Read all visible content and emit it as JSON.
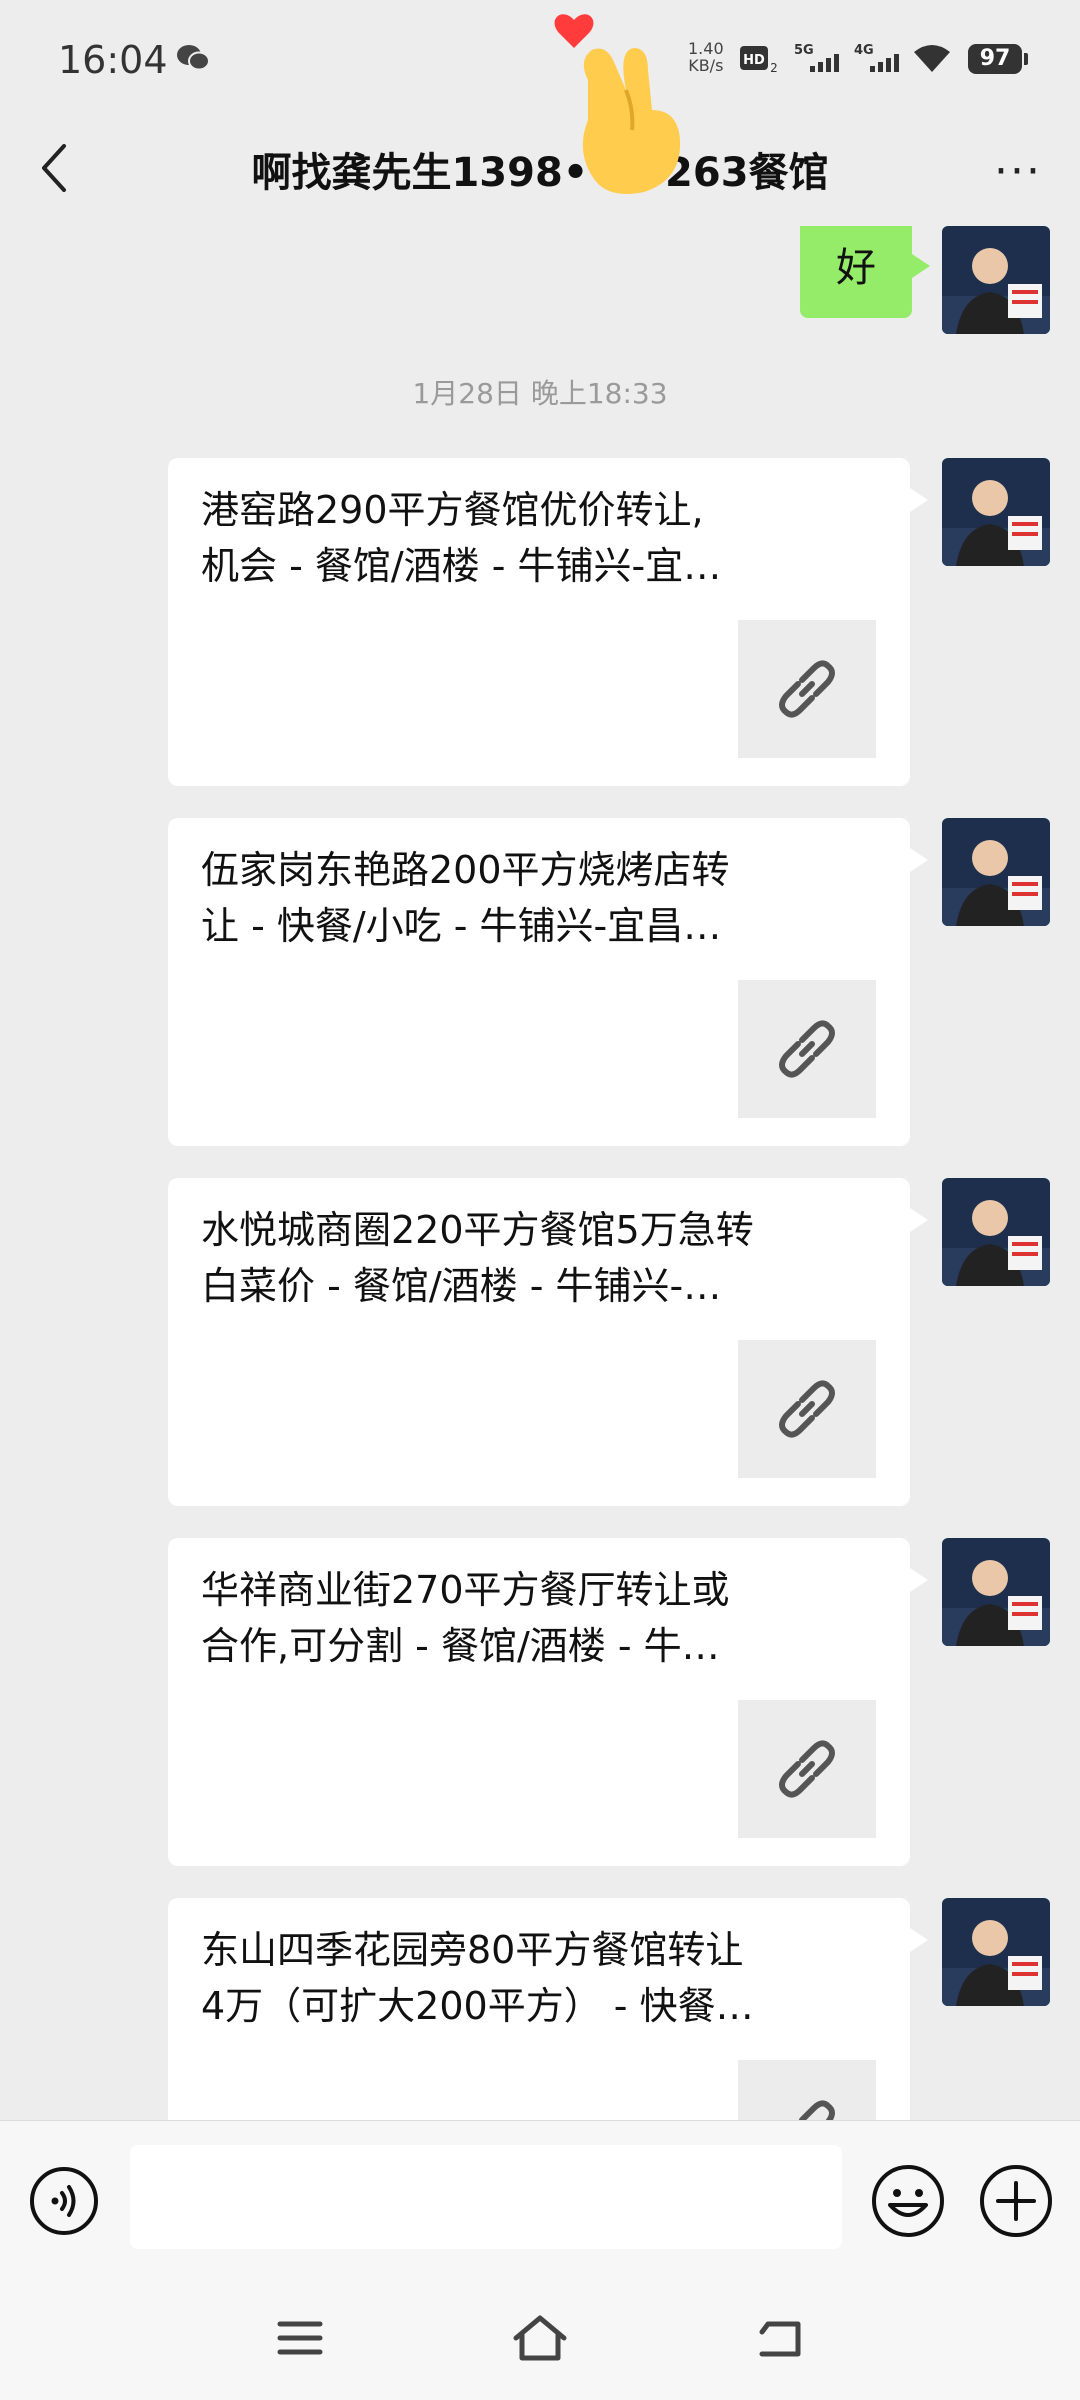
{
  "status_bar": {
    "time": "16:04",
    "net_speed_value": "1.40",
    "net_speed_unit": "KB/s",
    "hd_label": "HD",
    "signal1_label": "5G",
    "signal2_label": "4G",
    "battery": "97"
  },
  "header": {
    "back_icon": "chevron-left-icon",
    "title": "啊找龚先生1398••••263餐馆",
    "more": "···"
  },
  "chat": {
    "first_reply": "好",
    "timestamp": "1月28日 晚上18:33",
    "messages": [
      {
        "line1": "港窑路290平方餐馆优价转让,",
        "line2": "机会 - 餐馆/酒楼 - 牛铺兴-宜…"
      },
      {
        "line1": "伍家岗东艳路200平方烧烤店转",
        "line2": "让 - 快餐/小吃 - 牛铺兴-宜昌…"
      },
      {
        "line1": "水悦城商圈220平方餐馆5万急转",
        "line2": "白菜价 - 餐馆/酒楼 - 牛铺兴-…"
      },
      {
        "line1": "华祥商业街270平方餐厅转让或",
        "line2": "合作,可分割 - 餐馆/酒楼 - 牛…"
      },
      {
        "line1": "东山四季花园旁80平方餐馆转让",
        "line2": "4万（可扩大200平方） - 快餐…"
      }
    ]
  },
  "input_bar": {
    "voice_icon": "voice-icon",
    "emoji_icon": "emoji-icon",
    "plus_icon": "plus-icon"
  },
  "nav_bar": {
    "menu_icon": "menu-icon",
    "home_icon": "home-icon",
    "back_icon": "back-icon"
  },
  "colors": {
    "background": "#ededed",
    "sent_bubble": "#95ec69",
    "card": "#ffffff"
  }
}
